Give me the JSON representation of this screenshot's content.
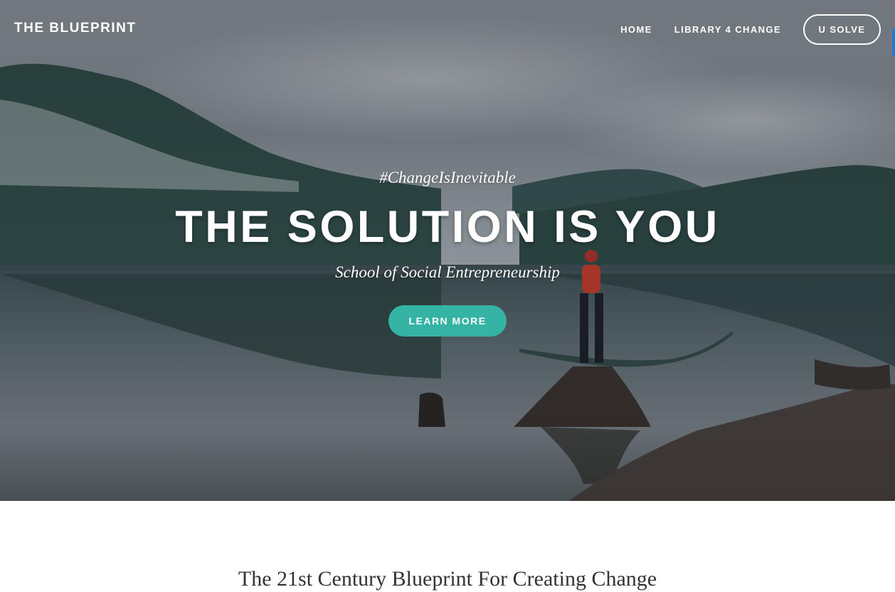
{
  "nav": {
    "brand": "THE BLUEPRINT",
    "links": [
      {
        "label": "HOME"
      },
      {
        "label": "LIBRARY 4 CHANGE"
      }
    ],
    "cta": "U SOLVE"
  },
  "hero": {
    "hashtag": "#ChangeIsInevitable",
    "headline": "THE SOLUTION IS YOU",
    "subtitle": "School of Social Entrepreneurship",
    "button": "LEARN MORE",
    "accent_color": "#35b3a4"
  },
  "section": {
    "heading": "The 21st Century Blueprint For Creating Change"
  }
}
